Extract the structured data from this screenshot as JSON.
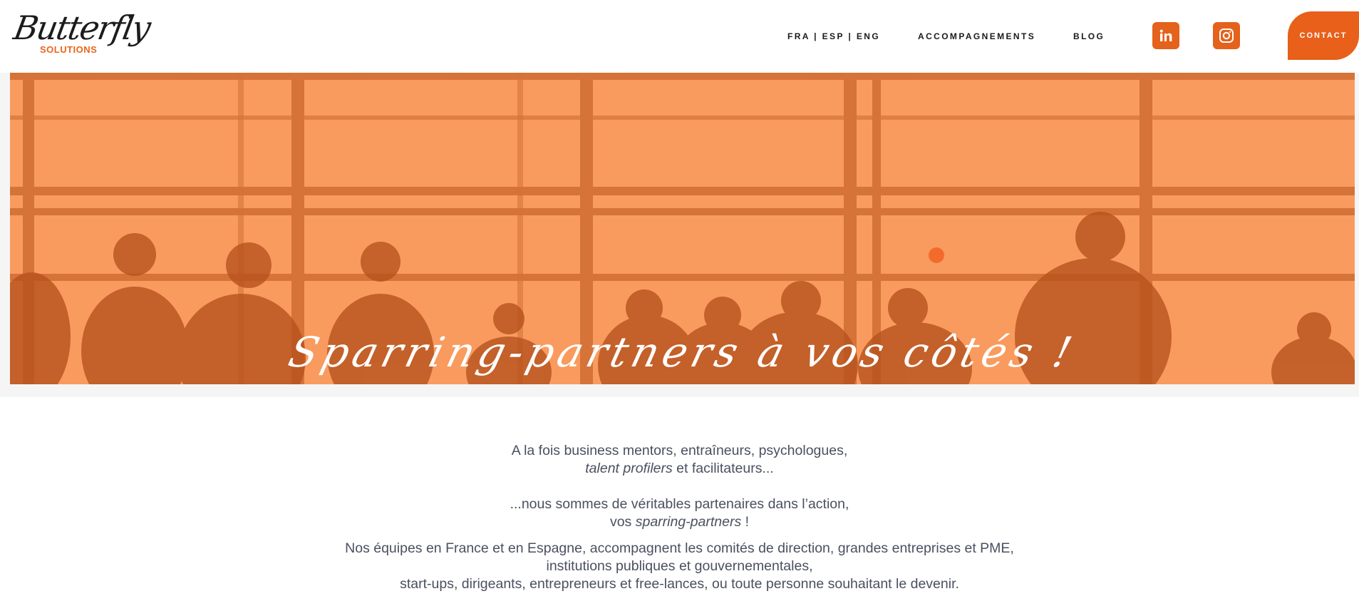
{
  "brand": {
    "logo_script": "Butterfly",
    "logo_sub": "SOLUTIONS",
    "accent": "#e8621b"
  },
  "nav": {
    "languages": "FRA | ESP | ENG",
    "accompagnements": "ACCOMPAGNEMENTS",
    "blog": "BLOG",
    "linkedin_icon": "linkedin-icon",
    "instagram_icon": "instagram-icon",
    "contact": "CONTACT"
  },
  "hero": {
    "title": "Sparring-partners à vos côtés !",
    "overlay_color": "#f99b5e"
  },
  "intro": {
    "line1": "A la fois business mentors, entraîneurs, psychologues,",
    "line2_em": "talent profilers",
    "line2_rest": " et facilitateurs...",
    "line3": "...nous sommes de véritables partenaires dans l’action,",
    "line4_pre": "vos ",
    "line4_em": "sparring-partners",
    "line4_post": " !",
    "line5": "Nos équipes en France et en Espagne, accompagnent les comités de direction, grandes entreprises et PME,",
    "line6": "institutions publiques et gouvernementales,",
    "line7": "start-ups, dirigeants, entrepreneurs et free-lances, ou toute personne souhaitant le devenir."
  }
}
